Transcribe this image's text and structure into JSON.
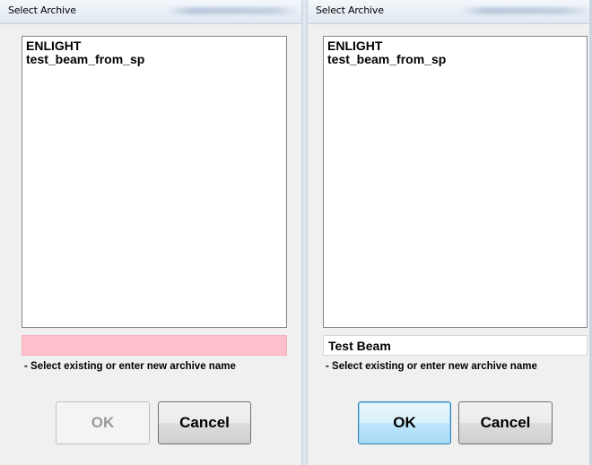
{
  "left_dialog": {
    "title": "Select Archive",
    "archives": [
      "ENLIGHT",
      "test_beam_from_sp"
    ],
    "name_input_value": "",
    "hint": "- Select existing or enter new archive name",
    "ok_label": "OK",
    "cancel_label": "Cancel",
    "input_background": "#ffc0cb"
  },
  "right_dialog": {
    "title": "Select Archive",
    "archives": [
      "ENLIGHT",
      "test_beam_from_sp"
    ],
    "name_input_value": "Test Beam",
    "hint": "- Select existing or enter new archive name",
    "ok_label": "OK",
    "cancel_label": "Cancel",
    "input_background": "#ffffff"
  }
}
